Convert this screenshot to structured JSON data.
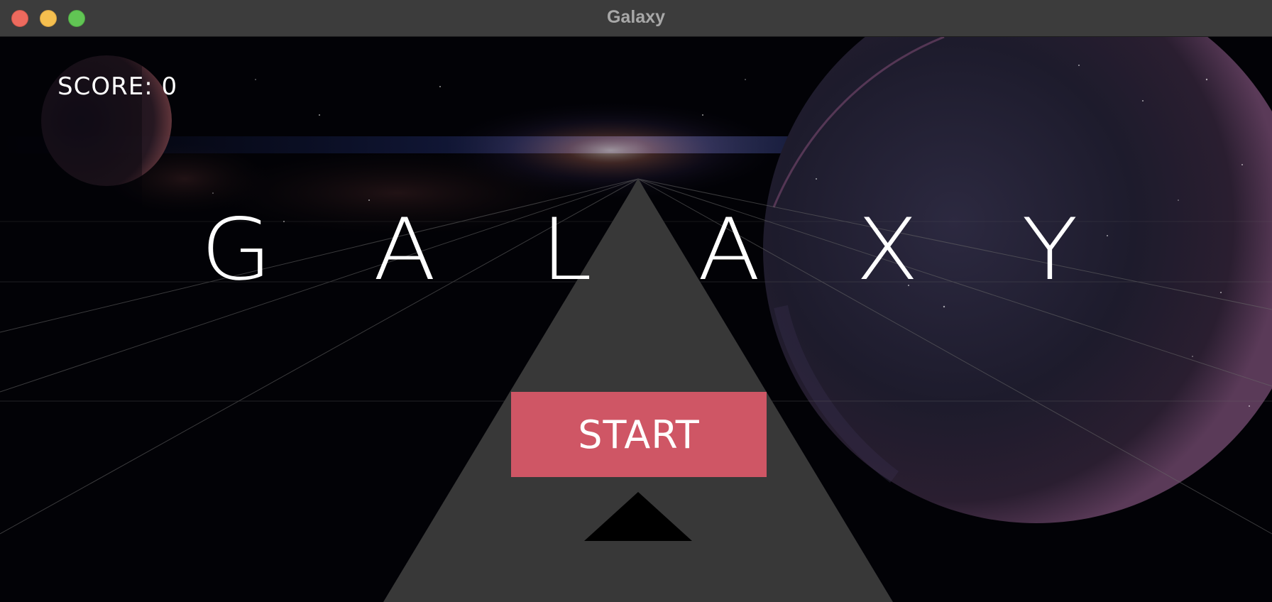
{
  "window": {
    "title": "Galaxy",
    "controls": [
      "close",
      "minimize",
      "zoom"
    ]
  },
  "game": {
    "score_label": "SCORE: 0",
    "logo_letters": [
      "G",
      "A",
      "L",
      "A",
      "X",
      "Y"
    ],
    "start_label": "START",
    "colors": {
      "track": "#383838",
      "start_button": "#cf5665",
      "ship": "#000000",
      "text": "#ffffff",
      "grid": "#5a5a5a"
    },
    "icons": {
      "ship": "triangle-ship-icon",
      "planet": "planet-icon",
      "moon": "moon-icon"
    }
  }
}
